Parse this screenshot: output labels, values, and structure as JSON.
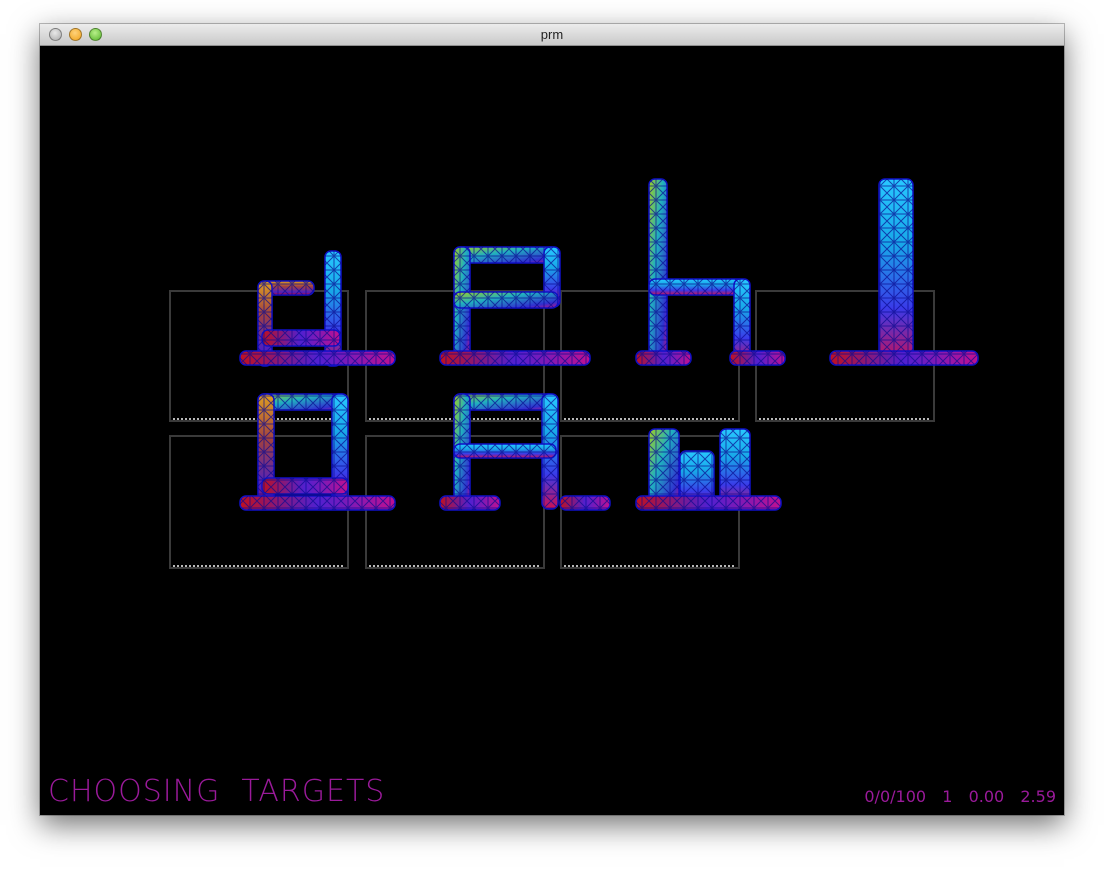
{
  "window": {
    "title": "prm"
  },
  "targets": {
    "letters": [
      "d",
      "e",
      "h",
      "l",
      "o",
      "a",
      "w"
    ]
  },
  "status": {
    "mode": "CHOOSING  TARGETS",
    "stats": "0/0/100  1  0.00  2.59"
  },
  "colors": {
    "status_text": "#9a1a9a",
    "background": "#000000",
    "target_box": "#3a3a3a"
  }
}
